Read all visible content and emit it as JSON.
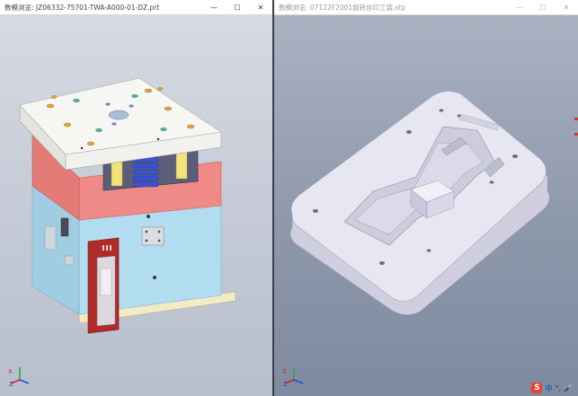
{
  "window_left": {
    "title": "数模浏览:  JZ06332-75701-TWA-A000-01-DZ.prt",
    "minimize": "—",
    "maximize": "☐",
    "close": "✕"
  },
  "window_right": {
    "title": "数模浏览:  07122F2001旋转丝印工装.stp",
    "minimize": "—",
    "maximize": "☐",
    "close": "✕"
  },
  "axis_labels": {
    "x": "X",
    "y": "Y",
    "z": "Z"
  },
  "ime": {
    "logo": "S",
    "lang": "中",
    "punct": "°,",
    "mic": "🎤"
  },
  "colors": {
    "mold_top": "#f1f1ee",
    "mold_red": "#ef8a86",
    "mold_blue": "#b2dcef",
    "mold_base": "#f1ecc6",
    "fixture": "#e3e3ee"
  }
}
